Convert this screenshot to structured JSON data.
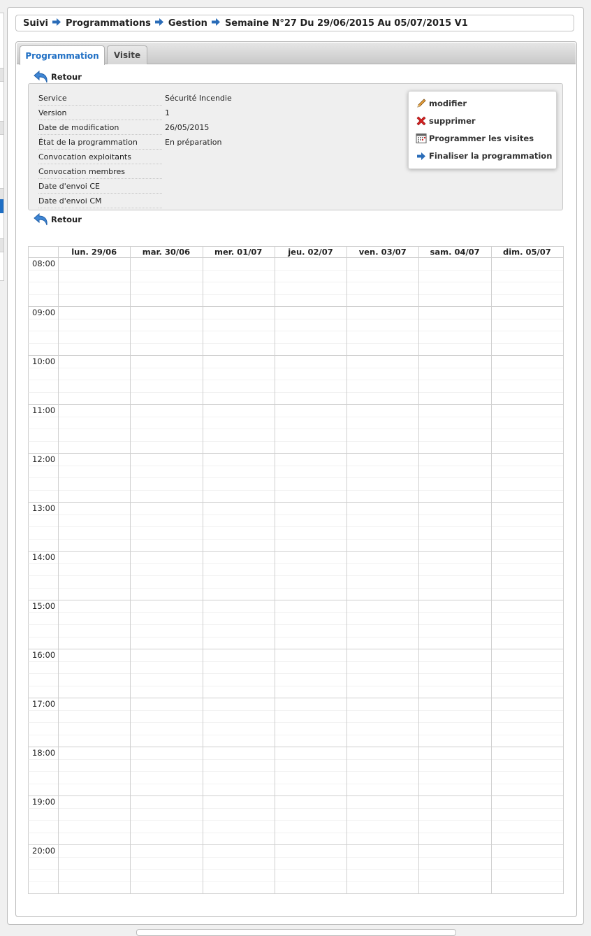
{
  "breadcrumb": {
    "items": [
      "Suivi",
      "Programmations",
      "Gestion",
      "Semaine N°27 Du 29/06/2015 Au 05/07/2015 V1"
    ]
  },
  "tabs": [
    {
      "label": "Programmation",
      "active": true
    },
    {
      "label": "Visite",
      "active": false
    }
  ],
  "retour_label": "Retour",
  "info": [
    {
      "label": "Service",
      "value": "Sécurité Incendie"
    },
    {
      "label": "Version",
      "value": "1"
    },
    {
      "label": "Date de modification",
      "value": "26/05/2015"
    },
    {
      "label": "État de la programmation",
      "value": "En préparation"
    },
    {
      "label": "Convocation exploitants",
      "value": ""
    },
    {
      "label": "Convocation membres",
      "value": ""
    },
    {
      "label": "Date d'envoi CE",
      "value": ""
    },
    {
      "label": "Date d'envoi CM",
      "value": ""
    }
  ],
  "actions": [
    {
      "label": "modifier",
      "icon": "pencil-icon"
    },
    {
      "label": "supprimer",
      "icon": "delete-icon"
    },
    {
      "label": "Programmer les visites",
      "icon": "calendar-icon"
    },
    {
      "label": "Finaliser la programmation",
      "icon": "arrow-right-icon"
    }
  ],
  "calendar": {
    "days": [
      "lun. 29/06",
      "mar. 30/06",
      "mer. 01/07",
      "jeu. 02/07",
      "ven. 03/07",
      "sam. 04/07",
      "dim. 05/07"
    ],
    "hours": [
      "08:00",
      "09:00",
      "10:00",
      "11:00",
      "12:00",
      "13:00",
      "14:00",
      "15:00",
      "16:00",
      "17:00",
      "18:00",
      "19:00",
      "20:00"
    ]
  },
  "colors": {
    "accent": "#1f6fc4",
    "arrow": "#2a6cb8",
    "delete": "#d62020"
  }
}
